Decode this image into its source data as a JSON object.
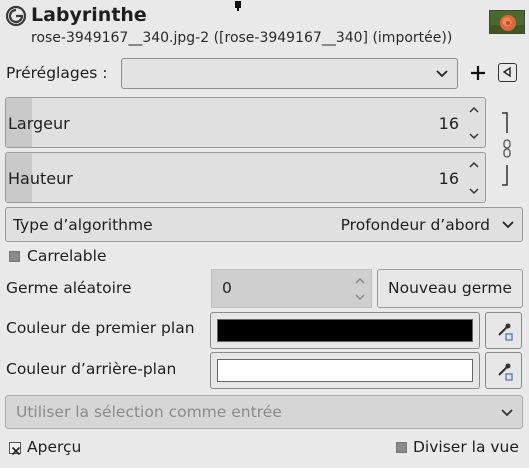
{
  "header": {
    "title": "Labyrinthe",
    "subtitle": "rose-3949167__340.jpg-2 ([rose-3949167__340] (importée))"
  },
  "presets": {
    "label": "Préréglages :",
    "value": "",
    "add_icon": "plus-icon",
    "manage_icon": "triangle-menu-icon"
  },
  "width": {
    "label": "Largeur",
    "value": "16"
  },
  "height": {
    "label": "Hauteur",
    "value": "16"
  },
  "algorithm": {
    "label": "Type d’algorithme",
    "value": "Profondeur d’abord"
  },
  "tileable": {
    "label": "Carrelable",
    "checked": false
  },
  "seed": {
    "label": "Germe aléatoire",
    "value": "0",
    "new_seed_label": "Nouveau germe"
  },
  "foreground": {
    "label": "Couleur de premier plan",
    "color": "#000000"
  },
  "background": {
    "label": "Couleur d’arrière-plan",
    "color": "#ffffff"
  },
  "selection": {
    "label": "Utiliser la sélection comme entrée"
  },
  "preview": {
    "label": "Aperçu",
    "checked": true
  },
  "split": {
    "label": "Diviser la vue",
    "checked": false
  }
}
